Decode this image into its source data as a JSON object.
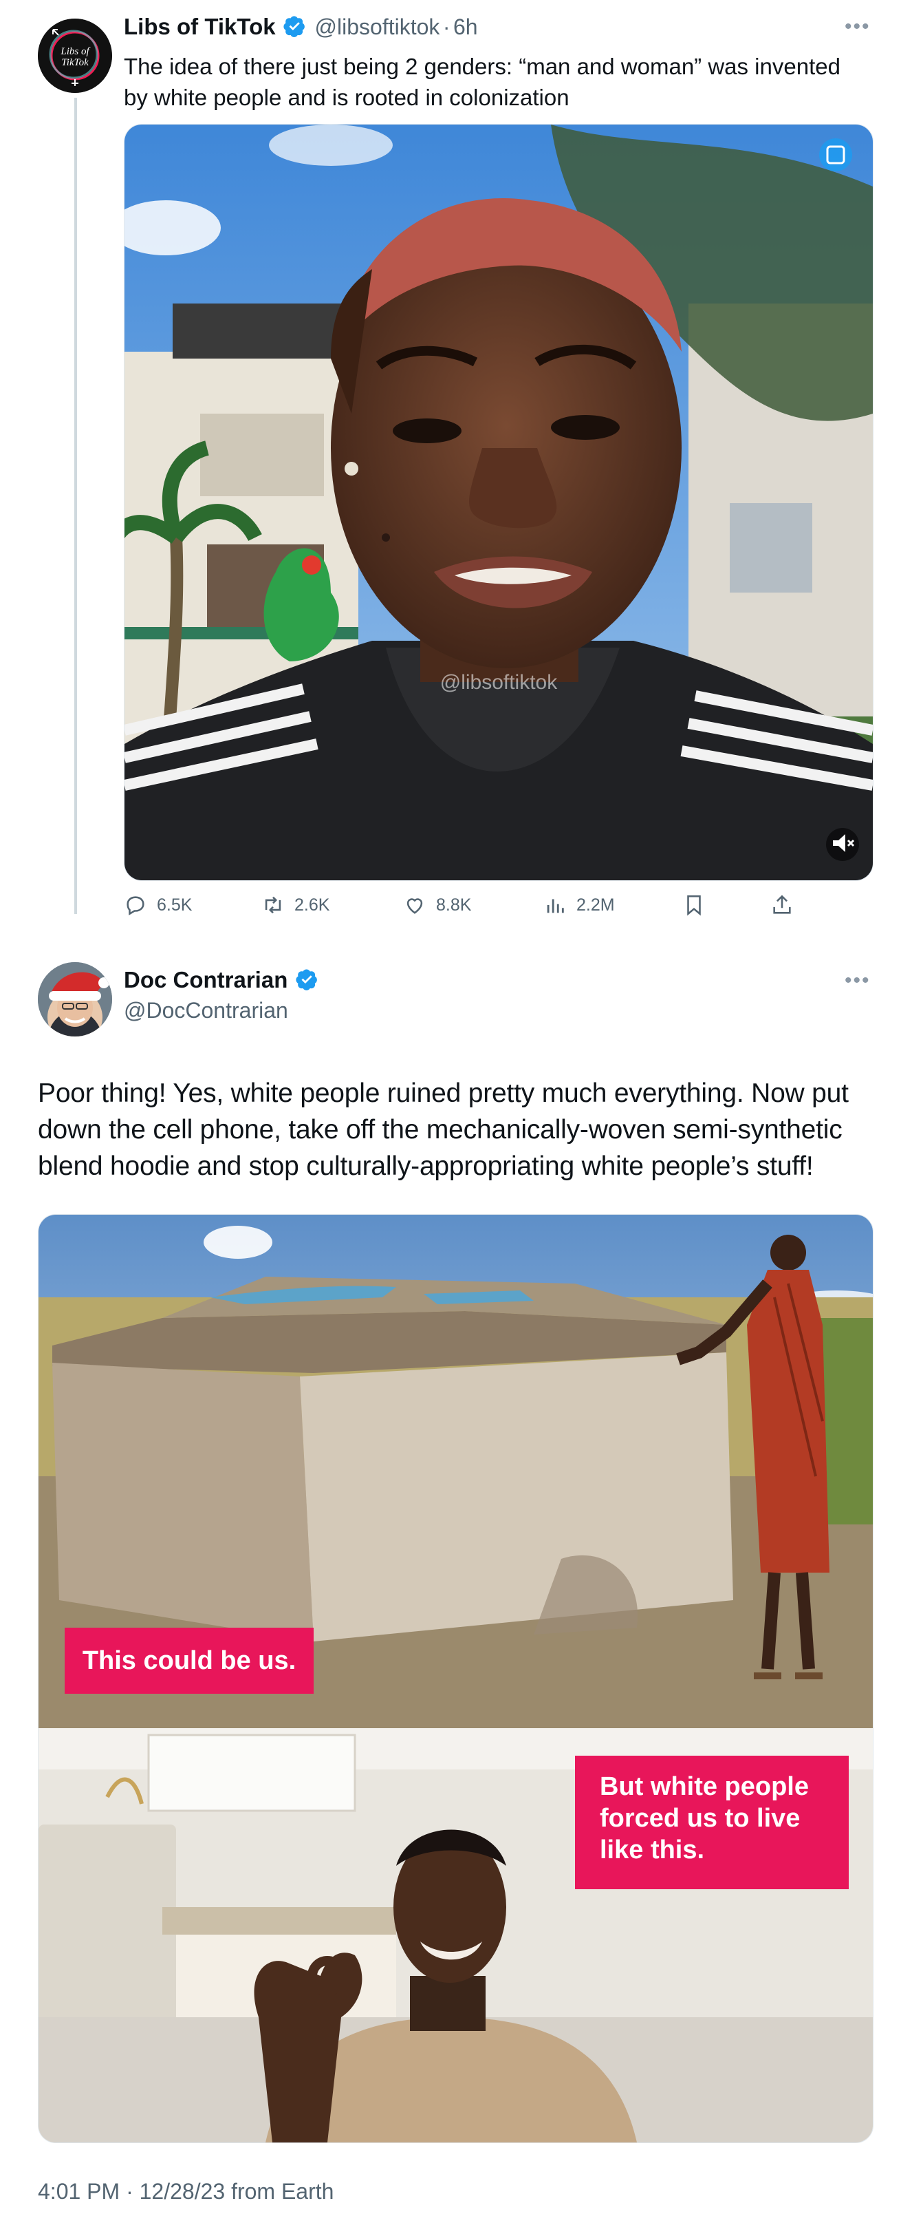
{
  "tweet1": {
    "avatar_text_top": "Libs of",
    "avatar_text_bottom": "TikTok",
    "display_name": "Libs of TikTok",
    "handle": "@libsoftiktok",
    "separator": "·",
    "time": "6h",
    "text_line1": "The idea of there just being 2 genders:  “man and woman” was invented",
    "text_line2": "by white people and is rooted in colonization",
    "video_watermark": "@libsoftiktok",
    "stats": {
      "replies": "6.5K",
      "retweets": "2.6K",
      "likes": "8.8K",
      "views": "2.2M"
    }
  },
  "tweet2": {
    "display_name": "Doc Contrarian",
    "handle": "@DocContrarian",
    "text_line1": "Poor thing! Yes, white people ruined pretty much everything. Now put",
    "text_line2": "down the cell phone, take off the mechanically-woven semi-synthetic",
    "text_line3": "blend hoodie and stop culturally-appropriating white people’s stuff!",
    "meme": {
      "caption_top": "This could be us.",
      "caption_bottom_line1": "But white people",
      "caption_bottom_line2": "forced us to live",
      "caption_bottom_line3": "like this."
    },
    "timestamp": "4:01 PM · 12/28/23 from Earth"
  },
  "colors": {
    "verified_blue": "#1d9bf0",
    "meme_pink": "#e8165a",
    "muted_text": "#536471"
  }
}
